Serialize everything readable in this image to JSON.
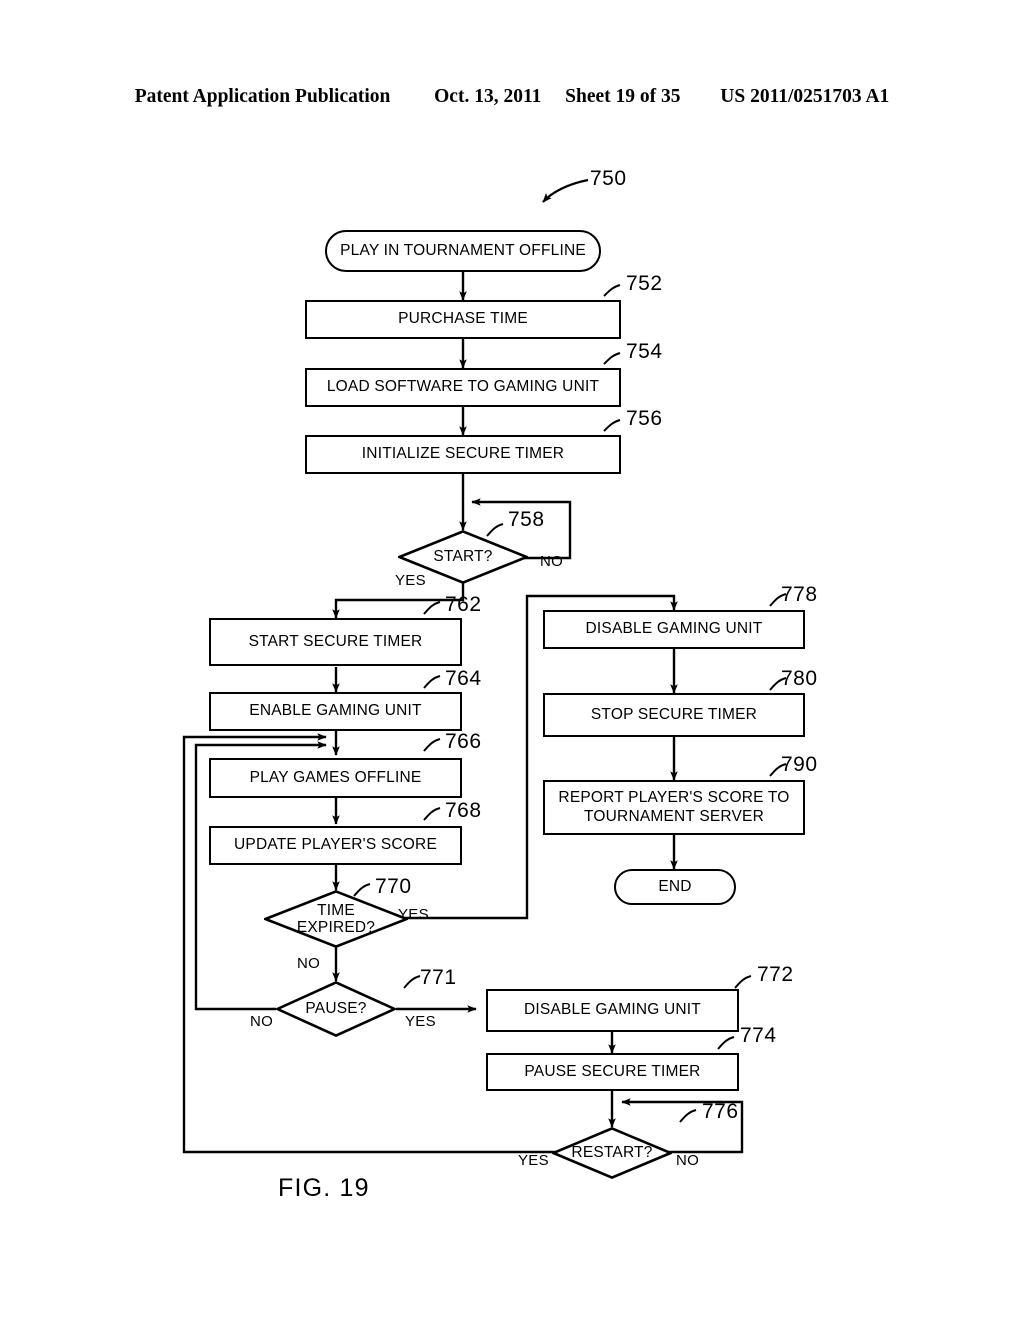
{
  "header": {
    "publication": "Patent Application Publication",
    "date": "Oct. 13, 2011",
    "sheet": "Sheet 19 of 35",
    "patent_number": "US 2011/0251703 A1"
  },
  "figure": {
    "caption": "FIG. 19",
    "diagram_ref": "750"
  },
  "nodes": {
    "start": {
      "label": "PLAY IN TOURNAMENT OFFLINE",
      "ref": ""
    },
    "purchase_time": {
      "label": "PURCHASE TIME",
      "ref": "752"
    },
    "load_software": {
      "label": "LOAD SOFTWARE TO GAMING UNIT",
      "ref": "754"
    },
    "initialize_timer": {
      "label": "INITIALIZE SECURE TIMER",
      "ref": "756"
    },
    "start_decision": {
      "label": "START?",
      "ref": "758"
    },
    "start_timer": {
      "label": "START SECURE TIMER",
      "ref": "762"
    },
    "enable_unit": {
      "label": "ENABLE GAMING UNIT",
      "ref": "764"
    },
    "play_games": {
      "label": "PLAY GAMES OFFLINE",
      "ref": "766"
    },
    "update_score": {
      "label": "UPDATE PLAYER'S SCORE",
      "ref": "768"
    },
    "time_expired": {
      "label_line1": "TIME",
      "label_line2": "EXPIRED?",
      "ref": "770"
    },
    "pause_decision": {
      "label": "PAUSE?",
      "ref": "771"
    },
    "disable_unit_pause": {
      "label": "DISABLE GAMING UNIT",
      "ref": "772"
    },
    "pause_timer": {
      "label": "PAUSE SECURE TIMER",
      "ref": "774"
    },
    "restart_decision": {
      "label": "RESTART?",
      "ref": "776"
    },
    "disable_unit_end": {
      "label": "DISABLE GAMING UNIT",
      "ref": "778"
    },
    "stop_timer": {
      "label": "STOP SECURE TIMER",
      "ref": "780"
    },
    "report_score": {
      "label_line1": "REPORT PLAYER'S SCORE TO",
      "label_line2": "TOURNAMENT SERVER",
      "ref": "790"
    },
    "end": {
      "label": "END",
      "ref": ""
    }
  },
  "edge_labels": {
    "start_yes": "YES",
    "start_no": "NO",
    "expired_yes": "YES",
    "expired_no": "NO",
    "pause_yes": "YES",
    "pause_no": "NO",
    "restart_yes": "YES",
    "restart_no": "NO"
  },
  "colors": {
    "ink": "#000000",
    "paper": "#ffffff"
  }
}
